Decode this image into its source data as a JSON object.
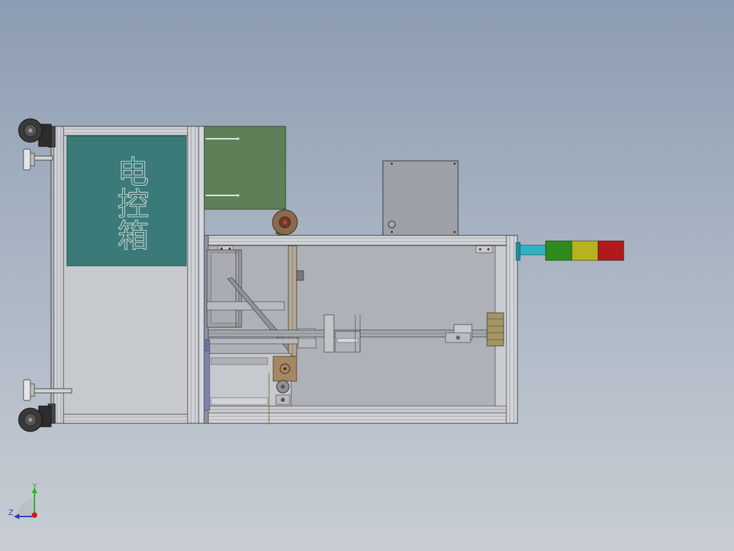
{
  "viewport": {
    "background_top": "#8c9cb2",
    "background_bottom": "#c8cdd3"
  },
  "model": {
    "cabinet_label": "电控箱",
    "panel_color": "#3a7a78",
    "plate_color": "#5f7f58",
    "frame_color": "#c9ccd2",
    "inner_color": "#aeb2b8"
  },
  "signal_tower": {
    "colors": [
      "#2fb3c3",
      "#2f8a1e",
      "#b7b21f",
      "#b11a1a"
    ]
  },
  "triad": {
    "y_label": "Y",
    "z_label": "Z",
    "y_color": "#1fb81f",
    "z_color": "#2a3cc9",
    "x_color": "#d01a1a"
  }
}
